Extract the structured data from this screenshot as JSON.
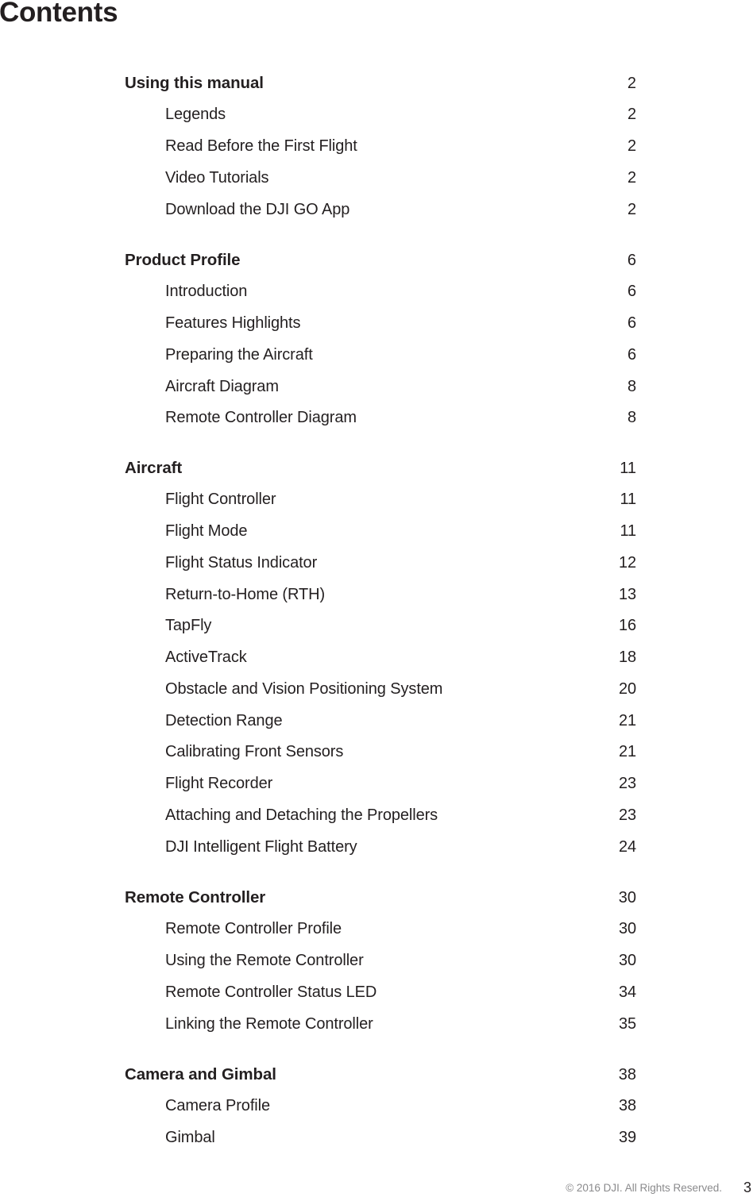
{
  "page_title": "Contents",
  "sections": [
    {
      "title": "Using this manual",
      "page": "2",
      "items": [
        {
          "title": "Legends",
          "page": "2"
        },
        {
          "title": "Read Before the First Flight",
          "page": "2"
        },
        {
          "title": "Video Tutorials",
          "page": "2"
        },
        {
          "title": "Download the DJI GO App",
          "page": "2"
        }
      ]
    },
    {
      "title": "Product Profile",
      "page": "6",
      "items": [
        {
          "title": "Introduction",
          "page": "6"
        },
        {
          "title": "Features Highlights",
          "page": "6"
        },
        {
          "title": "Preparing the Aircraft",
          "page": "6"
        },
        {
          "title": "Aircraft Diagram",
          "page": "8"
        },
        {
          "title": "Remote Controller Diagram",
          "page": "8"
        }
      ]
    },
    {
      "title": "Aircraft",
      "page": "11",
      "items": [
        {
          "title": "Flight Controller",
          "page": "11"
        },
        {
          "title": "Flight Mode",
          "page": "11"
        },
        {
          "title": "Flight Status Indicator",
          "page": "12"
        },
        {
          "title": "Return-to-Home (RTH)",
          "page": "13"
        },
        {
          "title": "TapFly",
          "page": "16"
        },
        {
          "title": "ActiveTrack",
          "page": "18"
        },
        {
          "title": "Obstacle and Vision Positioning System",
          "page": "20"
        },
        {
          "title": "Detection Range",
          "page": "21"
        },
        {
          "title": "Calibrating Front Sensors",
          "page": "21"
        },
        {
          "title": "Flight Recorder",
          "page": "23"
        },
        {
          "title": "Attaching and Detaching the Propellers",
          "page": "23"
        },
        {
          "title": "DJI Intelligent Flight Battery",
          "page": "24"
        }
      ]
    },
    {
      "title": "Remote Controller",
      "page": "30",
      "items": [
        {
          "title": "Remote Controller Profile",
          "page": "30"
        },
        {
          "title": "Using the Remote Controller",
          "page": "30"
        },
        {
          "title": "Remote Controller Status LED",
          "page": "34"
        },
        {
          "title": "Linking the Remote Controller",
          "page": "35"
        }
      ]
    },
    {
      "title": "Camera and Gimbal",
      "page": "38",
      "items": [
        {
          "title": "Camera Profile",
          "page": "38"
        },
        {
          "title": "Gimbal",
          "page": "39"
        }
      ]
    }
  ],
  "footer": {
    "copyright": "© 2016 DJI. All Rights Reserved.",
    "page_number": "3"
  }
}
